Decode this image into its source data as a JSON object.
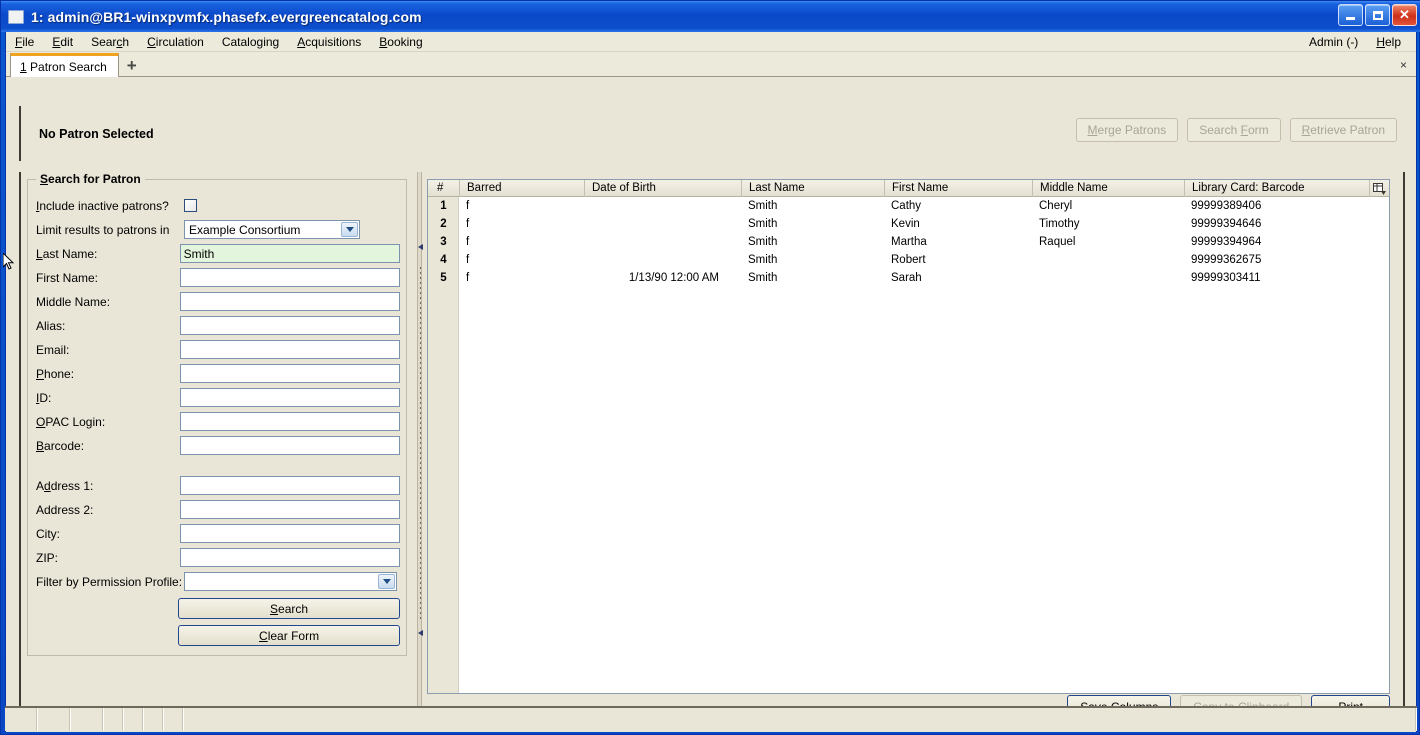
{
  "window": {
    "title": "1: admin@BR1-winxpvmfx.phasefx.evergreencatalog.com",
    "icon": "window-icon",
    "buttons": {
      "minimize": "minimize-icon",
      "maximize": "maximize-icon",
      "close": "✕"
    }
  },
  "menubar": {
    "items": [
      {
        "label": "File",
        "accel": "F"
      },
      {
        "label": "Edit",
        "accel": "E"
      },
      {
        "label": "Search",
        "accel": "c"
      },
      {
        "label": "Circulation",
        "accel": "C"
      },
      {
        "label": "Cataloging",
        "accel": "g"
      },
      {
        "label": "Acquisitions",
        "accel": "A"
      },
      {
        "label": "Booking",
        "accel": "B"
      }
    ],
    "right": [
      {
        "label": "Admin (-)"
      },
      {
        "label": "Help"
      }
    ]
  },
  "tabbar": {
    "active_tab_number": "1",
    "active_tab_label": "Patron Search",
    "add_tab": "+",
    "close_all": "×"
  },
  "patron_header": {
    "status": "No Patron Selected",
    "buttons": [
      {
        "label": "Merge Patrons",
        "enabled": false
      },
      {
        "label": "Search Form",
        "enabled": false
      },
      {
        "label": "Retrieve Patron",
        "enabled": false
      }
    ]
  },
  "search_form": {
    "legend": "Search for Patron",
    "fields": [
      {
        "label": "Include inactive patrons?",
        "type": "checkbox",
        "checked": false
      },
      {
        "label": "Limit results to patrons in",
        "type": "select",
        "value": "Example Consortium"
      },
      {
        "label": "Last Name:",
        "type": "text",
        "value": "Smith",
        "focused": true
      },
      {
        "label": "First Name:",
        "type": "text",
        "value": ""
      },
      {
        "label": "Middle Name:",
        "type": "text",
        "value": ""
      },
      {
        "label": "Alias:",
        "type": "text",
        "value": ""
      },
      {
        "label": "Email:",
        "type": "text",
        "value": ""
      },
      {
        "label": "Phone:",
        "type": "text",
        "value": ""
      },
      {
        "label": "ID:",
        "type": "text",
        "value": ""
      },
      {
        "label": "OPAC Login:",
        "type": "text",
        "value": ""
      },
      {
        "label": "Barcode:",
        "type": "text",
        "value": ""
      },
      {
        "label": "Address 1:",
        "type": "text",
        "value": ""
      },
      {
        "label": "Address 2:",
        "type": "text",
        "value": ""
      },
      {
        "label": "City:",
        "type": "text",
        "value": ""
      },
      {
        "label": "ZIP:",
        "type": "text",
        "value": ""
      },
      {
        "label": "Filter by Permission Profile:",
        "type": "select",
        "value": ""
      }
    ],
    "search_button": "Search",
    "clear_button": "Clear Form"
  },
  "results": {
    "columns": [
      "#",
      "Barred",
      "Date of Birth",
      "Last Name",
      "First Name",
      "Middle Name",
      "Library Card: Barcode"
    ],
    "column_picker_icon": "column-picker-icon",
    "rows": [
      {
        "num": "1",
        "barred": "f",
        "dob": "",
        "last": "Smith",
        "first": "Cathy",
        "middle": "Cheryl",
        "barcode": "99999389406"
      },
      {
        "num": "2",
        "barred": "f",
        "dob": "",
        "last": "Smith",
        "first": "Kevin",
        "middle": "Timothy",
        "barcode": "99999394646"
      },
      {
        "num": "3",
        "barred": "f",
        "dob": "",
        "last": "Smith",
        "first": "Martha",
        "middle": "Raquel",
        "barcode": "99999394964"
      },
      {
        "num": "4",
        "barred": "f",
        "dob": "",
        "last": "Smith",
        "first": "Robert",
        "middle": "",
        "barcode": "99999362675"
      },
      {
        "num": "5",
        "barred": "f",
        "dob": "1/13/90 12:00 AM",
        "last": "Smith",
        "first": "Sarah",
        "middle": "",
        "barcode": "99999303411"
      }
    ],
    "buttons": [
      {
        "label": "Save Columns",
        "enabled": true
      },
      {
        "label": "Copy to Clipboard",
        "enabled": false
      },
      {
        "label": "Print",
        "enabled": true
      }
    ]
  },
  "colors": {
    "titlebar_blue": "#0b49c9",
    "window_bg": "#e9e6d8",
    "focused_field_green": "#e4f5dd",
    "active_tab_accent": "#f0a31e",
    "default_button_border": "#22478f",
    "disabled_text": "#a9a596"
  }
}
